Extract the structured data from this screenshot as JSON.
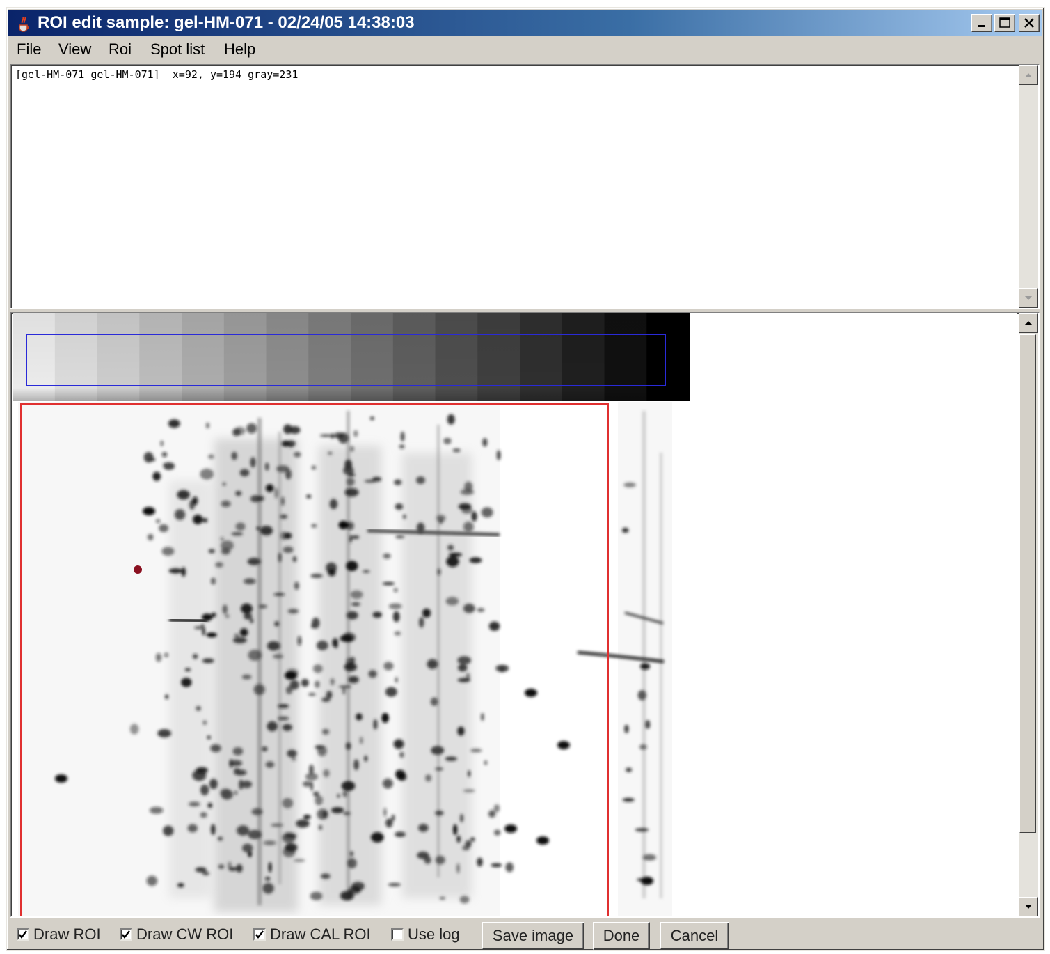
{
  "window": {
    "title": "ROI edit sample: gel-HM-071 - 02/24/05 14:38:03"
  },
  "menu": [
    "File",
    "View",
    "Roi",
    "Spot list",
    "Help"
  ],
  "info_pane": {
    "text": "[gel-HM-071 gel-HM-071]  x=92, y=194 gray=231"
  },
  "calibration_strip": {
    "step_count": 16,
    "roi_color": "#2a2ad8"
  },
  "gel_image": {
    "roi_color": "#e03030"
  },
  "controls": {
    "draw_roi": {
      "label": "Draw ROI",
      "checked": true
    },
    "draw_cw_roi": {
      "label": "Draw CW ROI",
      "checked": true
    },
    "draw_cal_roi": {
      "label": "Draw CAL ROI",
      "checked": true
    },
    "use_log": {
      "label": "Use log",
      "checked": false
    },
    "save_image_label": "Save image",
    "done_label": "Done",
    "cancel_label": "Cancel"
  },
  "colors": {
    "titlebar_start": "#0a246a",
    "titlebar_end": "#a6caf0",
    "chrome": "#d4d0c8"
  },
  "icons": {
    "app": "java-cup-icon",
    "minimize": "minimize-icon",
    "maximize": "maximize-icon",
    "close": "close-icon",
    "scroll_up": "arrow-up-icon",
    "scroll_down": "arrow-down-icon",
    "check": "checkmark-icon"
  }
}
